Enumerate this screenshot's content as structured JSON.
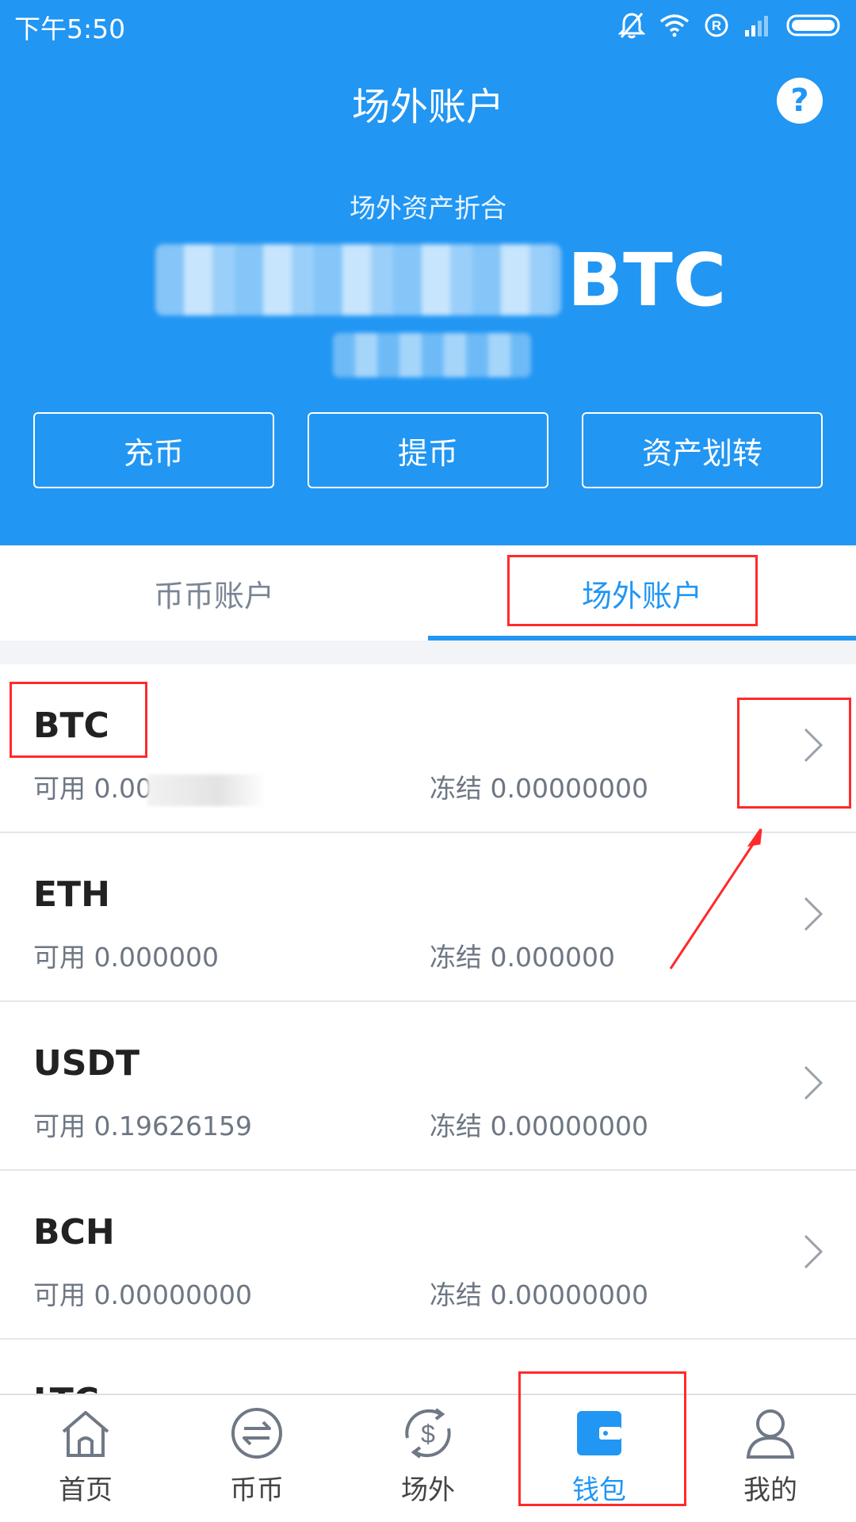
{
  "status": {
    "time": "下午5:50"
  },
  "header": {
    "title": "场外账户",
    "help": "?",
    "total_label": "场外资产折合",
    "total_unit": "BTC"
  },
  "actions": [
    "充币",
    "提币",
    "资产划转"
  ],
  "tabs": [
    {
      "label": "币币账户",
      "active": false
    },
    {
      "label": "场外账户",
      "active": true
    }
  ],
  "accounts": [
    {
      "coin": "BTC",
      "available": "可用 0.00",
      "frozen": "冻结 0.00000000"
    },
    {
      "coin": "ETH",
      "available": "可用 0.000000",
      "frozen": "冻结 0.000000"
    },
    {
      "coin": "USDT",
      "available": "可用 0.19626159",
      "frozen": "冻结 0.00000000"
    },
    {
      "coin": "BCH",
      "available": "可用 0.00000000",
      "frozen": "冻结 0.00000000"
    },
    {
      "coin": "LTC",
      "available": "",
      "frozen": ""
    }
  ],
  "bottom_nav": [
    {
      "label": "首页",
      "icon": "home-icon"
    },
    {
      "label": "币币",
      "icon": "exchange-icon"
    },
    {
      "label": "场外",
      "icon": "otc-dollar-icon"
    },
    {
      "label": "钱包",
      "icon": "wallet-icon",
      "active": true
    },
    {
      "label": "我的",
      "icon": "user-icon"
    }
  ],
  "colors": {
    "primary": "#2196F3",
    "annotation": "#ff2a2a"
  }
}
